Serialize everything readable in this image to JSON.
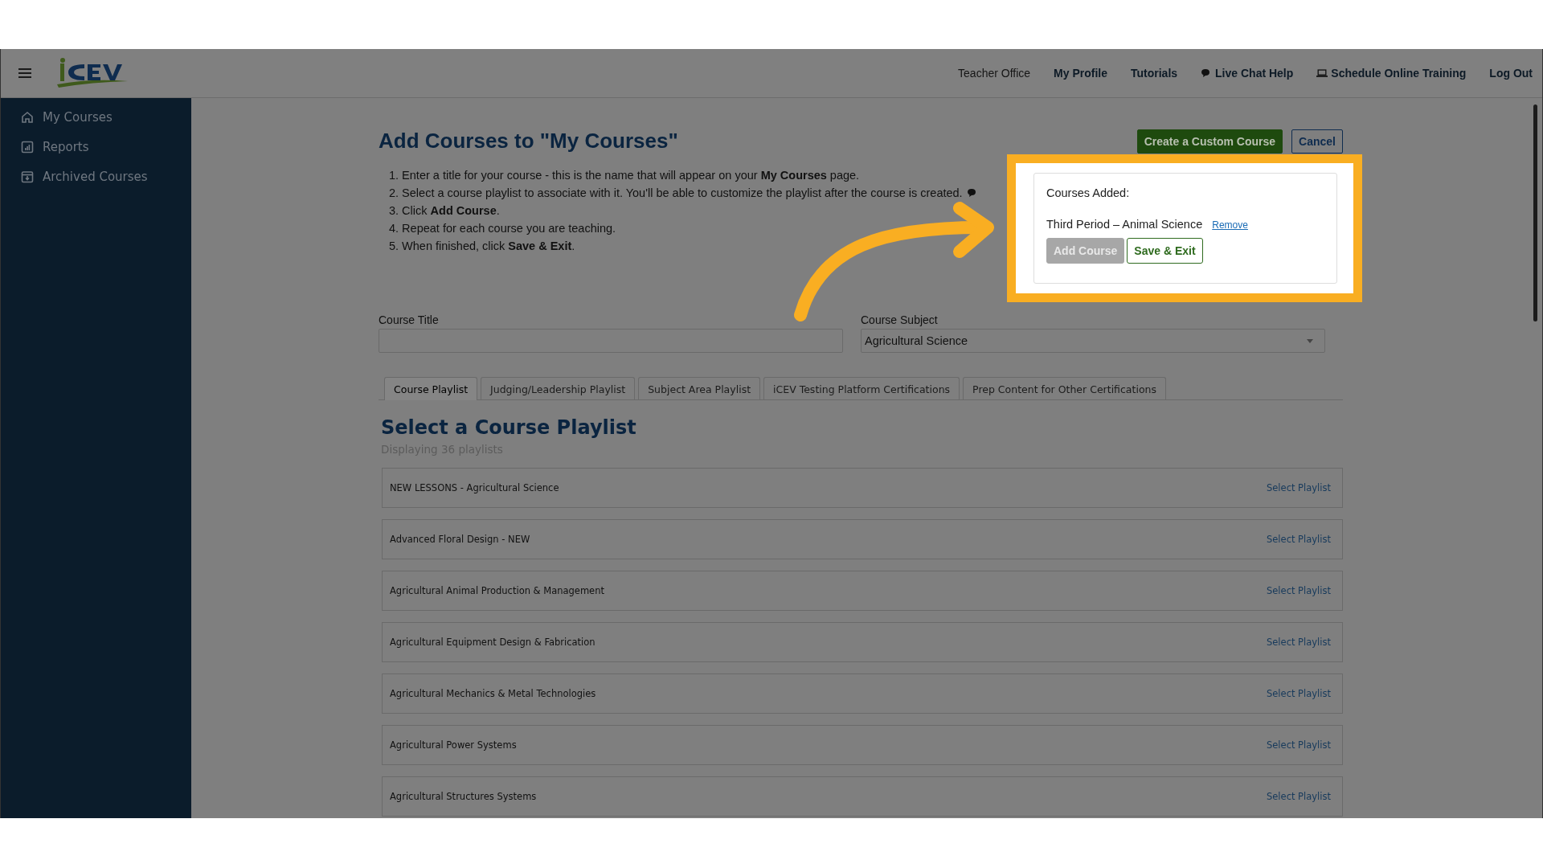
{
  "header": {
    "nav": [
      {
        "label": "Teacher Office",
        "kind": "plain"
      },
      {
        "label": "My Profile",
        "kind": "link"
      },
      {
        "label": "Tutorials",
        "kind": "link"
      },
      {
        "label": "Live Chat Help",
        "kind": "chat"
      },
      {
        "label": "Schedule Online Training",
        "kind": "training"
      },
      {
        "label": "Log Out",
        "kind": "link"
      }
    ]
  },
  "sidebar": {
    "items": [
      {
        "label": "My Courses",
        "kind": "home"
      },
      {
        "label": "Reports",
        "kind": "reports"
      },
      {
        "label": "Archived Courses",
        "kind": "archive"
      }
    ]
  },
  "page": {
    "title": "Add Courses to \"My Courses\"",
    "buttons": [
      {
        "label": "Create a Custom Course",
        "kind": "primary"
      },
      {
        "label": "Cancel",
        "kind": "outline"
      }
    ],
    "instructions": [
      "1. Enter a title for your course - this is the name that will appear on your **My Courses** page.",
      "2. Select a course playlist to associate with it. You'll be able to customize the playlist after the course is created.",
      "3. Click **Add Course**.",
      "4. Repeat for each course you are teaching.",
      "5. When finished, click **Save & Exit**."
    ]
  },
  "popup": {
    "heading": "Courses Added:",
    "course": {
      "title": "Third Period – Animal Science",
      "remove": "Remove"
    },
    "buttons": [
      {
        "label": "Add Course",
        "disabled": true
      },
      {
        "label": "Save & Exit",
        "disabled": false
      }
    ]
  },
  "form": {
    "course_title": {
      "label": "Course Title"
    },
    "course_subject": {
      "label": "Course Subject",
      "value": "Agricultural Science"
    }
  },
  "tabs": [
    {
      "label": "Course Playlist",
      "selected": true
    },
    {
      "label": "Judging/Leadership Playlist",
      "selected": false
    },
    {
      "label": "Subject Area Playlist",
      "selected": false
    },
    {
      "label": "iCEV Testing Platform Certifications",
      "selected": false
    },
    {
      "label": "Prep Content for Other Certifications",
      "selected": false
    }
  ],
  "playlists": {
    "title": "Select a Course Playlist",
    "count": "Displaying 36 playlists",
    "rows": [
      {
        "name": "NEW LESSONS - Agricultural Science",
        "action": "Select Playlist"
      },
      {
        "name": "Advanced Floral Design - NEW",
        "action": "Select Playlist"
      },
      {
        "name": "Agricultural Animal Production & Management",
        "action": "Select Playlist"
      },
      {
        "name": "Agricultural Equipment Design & Fabrication",
        "action": "Select Playlist"
      },
      {
        "name": "Agricultural Mechanics & Metal Technologies",
        "action": "Select Playlist"
      },
      {
        "name": "Agricultural Power Systems",
        "action": "Select Playlist"
      },
      {
        "name": "Agricultural Structures Systems",
        "action": "Select Playlist"
      }
    ]
  }
}
